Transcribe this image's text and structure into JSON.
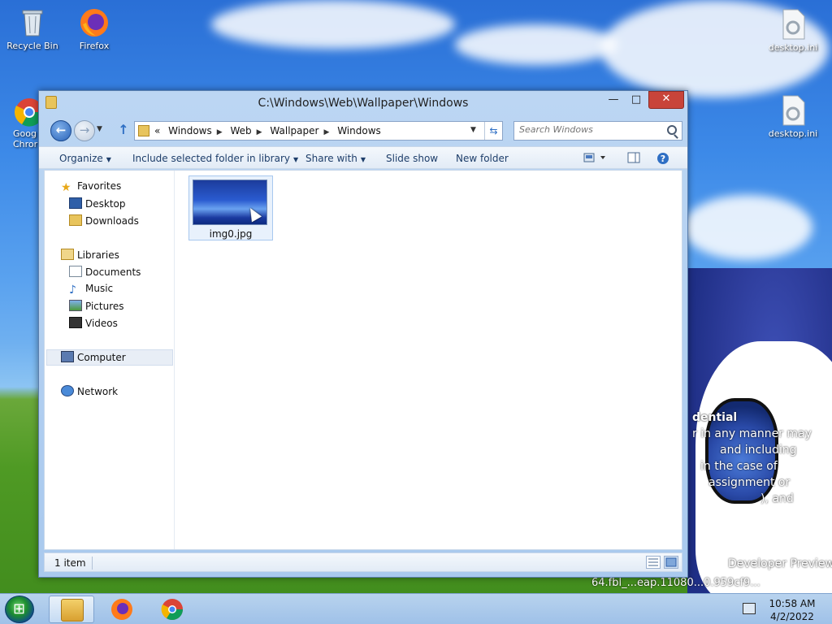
{
  "desktop": {
    "icons": [
      {
        "label": "Recycle Bin"
      },
      {
        "label": "Firefox"
      },
      {
        "label": "Goog Chror"
      },
      {
        "label": "desktop.ini"
      },
      {
        "label": "desktop.ini"
      }
    ],
    "watermark_lines": [
      "dential",
      "r in any manner may",
      "and including",
      "in the case of",
      "assignment or",
      "), and",
      "Developer Preview",
      "64.fbl_...eap.11080...0.959cf9..."
    ]
  },
  "window": {
    "title": "C:\\Windows\\Web\\Wallpaper\\Windows",
    "minimize_label": "—",
    "maximize_label": "□",
    "close_label": "✕"
  },
  "nav": {
    "breadcrumbs": [
      "«",
      "Windows",
      "Web",
      "Wallpaper",
      "Windows"
    ],
    "search_placeholder": "Search Windows"
  },
  "toolbar": {
    "organize": "Organize",
    "include": "Include selected folder in library",
    "share": "Share with",
    "slideshow": "Slide show",
    "newfolder": "New folder"
  },
  "sidebar": {
    "favorites": "Favorites",
    "desktop": "Desktop",
    "downloads": "Downloads",
    "libraries": "Libraries",
    "documents": "Documents",
    "music": "Music",
    "pictures": "Pictures",
    "videos": "Videos",
    "computer": "Computer",
    "network": "Network"
  },
  "files": [
    {
      "name": "img0.jpg"
    }
  ],
  "status": {
    "count": "1 item"
  },
  "taskbar": {
    "time": "10:58 AM",
    "date": "4/2/2022"
  },
  "colors": {
    "close_button": "#c8443a",
    "window_frame": "#bcd6f3",
    "taskbar": "#b8d3ee"
  }
}
